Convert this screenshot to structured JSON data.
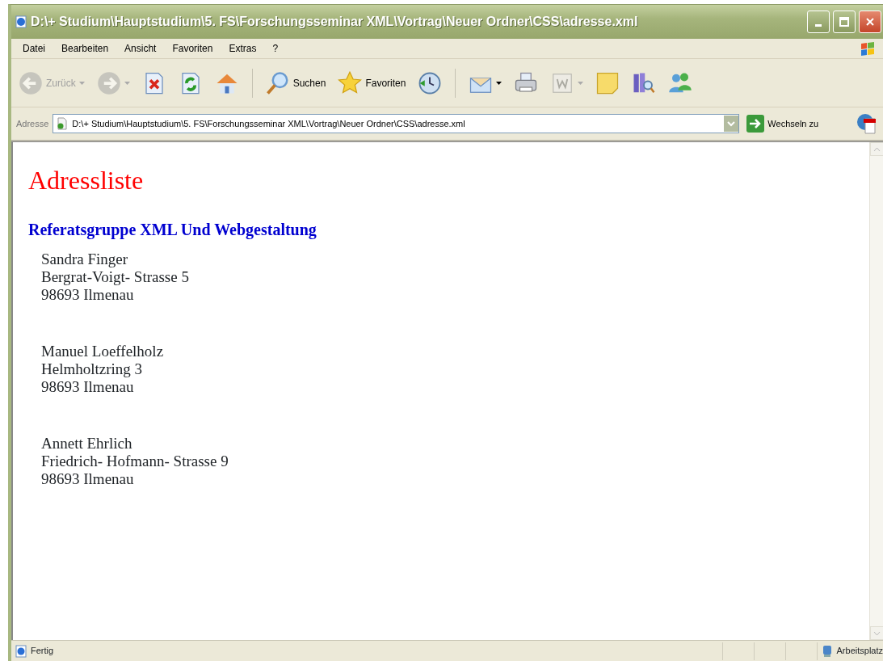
{
  "window": {
    "title": "D:\\+ Studium\\Hauptstudium\\5. FS\\Forschungsseminar XML\\Vortrag\\Neuer Ordner\\CSS\\adresse.xml"
  },
  "menu": [
    "Datei",
    "Bearbeiten",
    "Ansicht",
    "Favoriten",
    "Extras",
    "?"
  ],
  "toolbar": [
    {
      "kind": "back",
      "label": "Zurück",
      "disabled": true,
      "dropdown": true
    },
    {
      "kind": "forward",
      "disabled": true,
      "dropdown": true
    },
    {
      "kind": "stop",
      "disabled": false,
      "dropdown": false
    },
    {
      "kind": "refresh",
      "disabled": false,
      "dropdown": false
    },
    {
      "kind": "home",
      "disabled": false,
      "dropdown": false
    },
    {
      "kind": "separator"
    },
    {
      "kind": "search",
      "label": "Suchen",
      "disabled": false,
      "dropdown": false
    },
    {
      "kind": "favorites",
      "label": "Favoriten",
      "disabled": false,
      "dropdown": false
    },
    {
      "kind": "history",
      "disabled": false,
      "dropdown": false
    },
    {
      "kind": "separator"
    },
    {
      "kind": "mail",
      "disabled": false,
      "dropdown": true
    },
    {
      "kind": "print",
      "disabled": false,
      "dropdown": false
    },
    {
      "kind": "edit",
      "disabled": true,
      "dropdown": true
    },
    {
      "kind": "note",
      "disabled": false,
      "dropdown": false
    },
    {
      "kind": "research",
      "disabled": false,
      "dropdown": false
    },
    {
      "kind": "messenger",
      "disabled": false,
      "dropdown": false
    }
  ],
  "address": {
    "label": "Adresse",
    "value": "D:\\+ Studium\\Hauptstudium\\5. FS\\Forschungsseminar XML\\Vortrag\\Neuer Ordner\\CSS\\adresse.xml",
    "go": "Wechseln zu"
  },
  "page": {
    "heading": "Adressliste",
    "group": "Referatsgruppe XML Und Webgestaltung",
    "addresses": [
      {
        "name": "Sandra Finger",
        "street": "Bergrat-Voigt- Strasse 5",
        "city": "98693 Ilmenau"
      },
      {
        "name": "Manuel Loeffelholz",
        "street": "Helmholtzring 3",
        "city": "98693 Ilmenau"
      },
      {
        "name": "Annett Ehrlich",
        "street": "Friedrich- Hofmann- Strasse 9",
        "city": "98693 Ilmenau"
      }
    ]
  },
  "status_bar": {
    "text": "Fertig",
    "zone": "Arbeitsplatz"
  }
}
